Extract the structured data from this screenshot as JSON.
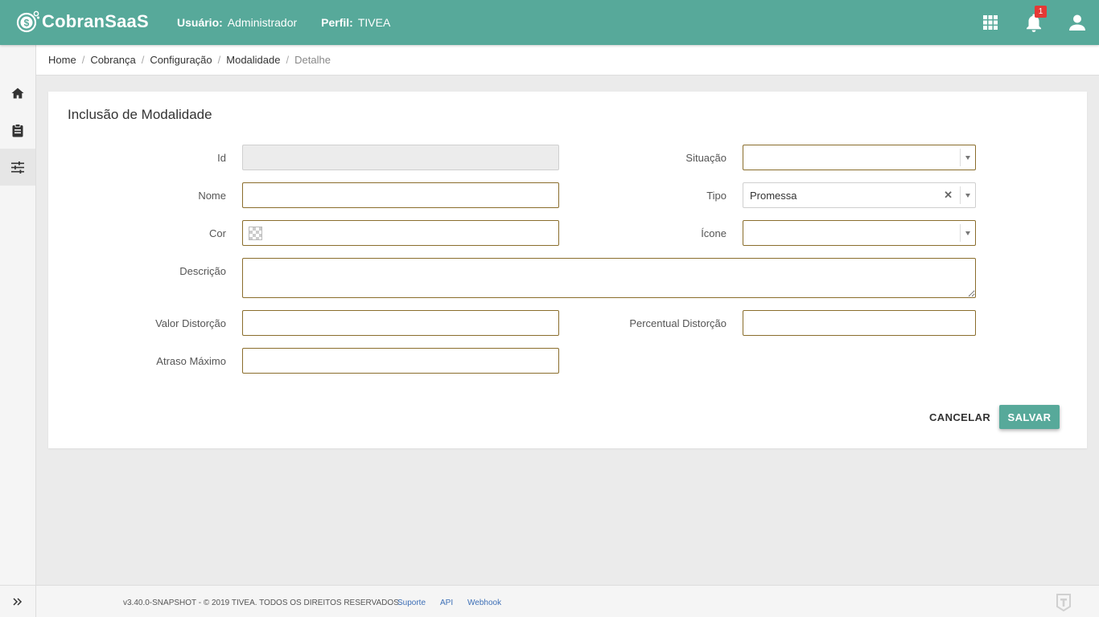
{
  "header": {
    "logo_text": "CobranSaaS",
    "user_label": "Usuário:",
    "user_value": "Administrador",
    "profile_label": "Perfil:",
    "profile_value": "TIVEA",
    "notification_count": "1",
    "brand_color": "#57a99a"
  },
  "sidebar": {
    "items": [
      {
        "icon": "home-icon"
      },
      {
        "icon": "clipboard-icon"
      },
      {
        "icon": "settings-sliders-icon"
      }
    ],
    "expand_icon": "double-chevron-right-icon"
  },
  "breadcrumb": [
    "Home",
    "Cobrança",
    "Configuração",
    "Modalidade",
    "Detalhe"
  ],
  "form": {
    "title": "Inclusão de Modalidade",
    "fields": {
      "id": {
        "label": "Id",
        "value": ""
      },
      "nome": {
        "label": "Nome",
        "value": ""
      },
      "cor": {
        "label": "Cor",
        "value": ""
      },
      "descricao": {
        "label": "Descrição",
        "value": ""
      },
      "valor_distorcao": {
        "label": "Valor Distorção",
        "value": ""
      },
      "atraso_maximo": {
        "label": "Atraso Máximo",
        "value": ""
      },
      "situacao": {
        "label": "Situação",
        "value": ""
      },
      "tipo": {
        "label": "Tipo",
        "value": "Promessa"
      },
      "icone": {
        "label": "Ícone",
        "value": ""
      },
      "percentual_distorcao": {
        "label": "Percentual Distorção",
        "value": ""
      }
    },
    "cancel_label": "CANCELAR",
    "save_label": "SALVAR"
  },
  "footer": {
    "copyright": "v3.40.0-SNAPSHOT - © 2019 TIVEA. TODOS OS DIREITOS RESERVADOS.",
    "links": [
      "Suporte",
      "API",
      "Webhook"
    ]
  }
}
